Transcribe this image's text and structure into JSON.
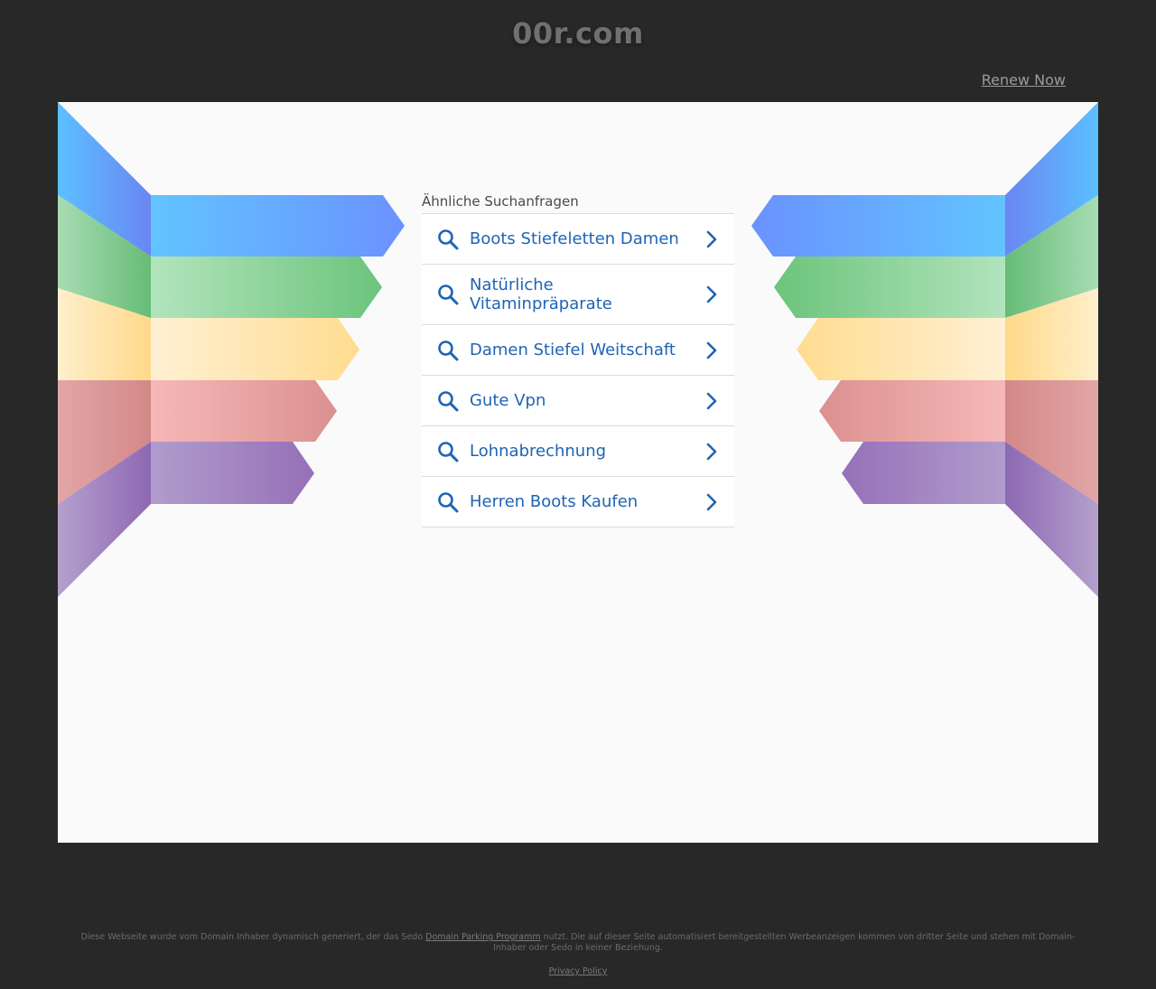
{
  "header": {
    "domain": "00r.com",
    "renew_label": "Renew Now"
  },
  "related": {
    "heading": "Ähnliche Suchanfragen",
    "items": [
      {
        "label": "Boots Stiefeletten Damen"
      },
      {
        "label": "Natürliche Vitaminpräparate"
      },
      {
        "label": "Damen Stiefel Weitschaft"
      },
      {
        "label": "Gute Vpn"
      },
      {
        "label": "Lohnabrechnung"
      },
      {
        "label": "Herren Boots Kaufen"
      }
    ]
  },
  "footer": {
    "text_before": "Diese Webseite wurde vom Domain Inhaber dynamisch generiert, der das Sedo ",
    "link_label": "Domain Parking Programm",
    "text_after": " nutzt. Die auf dieser Seite automatisiert bereitgestellten Werbeanzeigen kommen von dritter Seite und stehen mit Domain-Inhaber oder Sedo in keiner Beziehung.",
    "privacy_label": "Privacy Policy"
  },
  "colors": {
    "background": "#282828",
    "panel": "#fafafa",
    "link": "#1e64b4",
    "ribbon_blue": "#5aa6ff",
    "ribbon_green": "#6ec47e",
    "ribbon_yellow": "#ffe19a",
    "ribbon_red": "#e89a9a",
    "ribbon_purple": "#9a78bc"
  },
  "icons": {
    "search": "search-icon",
    "chevron": "chevron-right-icon"
  }
}
